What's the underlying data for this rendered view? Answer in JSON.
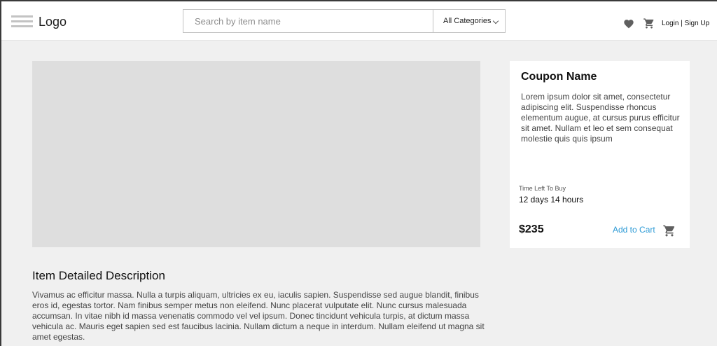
{
  "header": {
    "logo": "Logo",
    "search": {
      "placeholder": "Search by item name",
      "value": ""
    },
    "category_select": {
      "selected": "All Categories"
    },
    "icons": [
      "hamburger-menu-icon",
      "heart-icon",
      "cart-icon"
    ],
    "auth_label": "Login | Sign Up"
  },
  "coupon": {
    "name": "Coupon Name",
    "description": "Lorem ipsum dolor sit amet, consectetur adipiscing elit. Suspendisse rhoncus elementum augue, at cursus purus efficitur sit amet. Nullam et leo et sem consequat molestie quis quis ipsum",
    "time_left_label": "Time Left To Buy",
    "time_left_value": "12 days 14 hours",
    "price": "$235",
    "add_to_cart_label": "Add to Cart"
  },
  "item": {
    "description_title": "Item Detailed Description",
    "description_body": "Vivamus ac efficitur massa. Nulla a turpis aliquam, ultricies ex eu, iaculis sapien. Suspendisse sed augue blandit, finibus eros id, egestas tortor. Nam finibus semper metus non eleifend. Nunc placerat vulputate elit. Nunc cursus malesuada accumsan. In vitae nibh id massa venenatis commodo vel vel ipsum. Donec tincidunt vehicula turpis, at dictum massa vehicula ac. Mauris eget sapien sed est faucibus lacinia. Nullam dictum a neque in interdum. Nullam eleifend ut magna sit amet egestas."
  },
  "colors": {
    "accent_link": "#2e9bd6",
    "page_background": "#f0f0f0",
    "image_placeholder": "#dedede",
    "icon_gray": "#5f5f5f"
  }
}
